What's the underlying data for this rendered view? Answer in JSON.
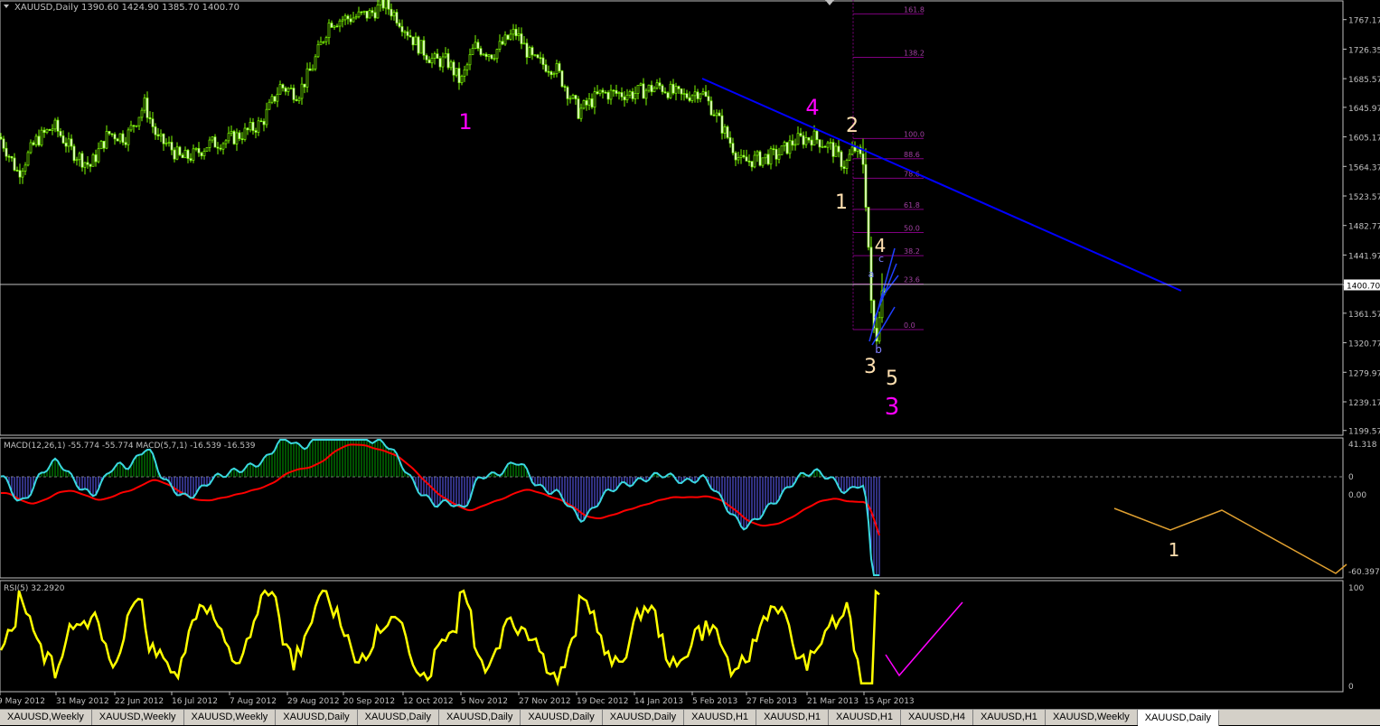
{
  "window_title": "XAUUSD,Daily",
  "header": {
    "symbol": "XAUUSD,Daily",
    "ohlc": "1390.60 1424.90 1385.70 1400.70"
  },
  "current_price": "1400.70",
  "chart_data": [
    {
      "type": "candlestick",
      "title": "XAUUSD,Daily",
      "y_ticks": [
        "1767.17",
        "1726.35",
        "1685.57",
        "1645.97",
        "1605.17",
        "1564.37",
        "1523.57",
        "1482.77",
        "1441.97",
        "1400.70",
        "1361.57",
        "1320.77",
        "1279.97",
        "1239.17",
        "1199.57"
      ],
      "ylim": [
        1193,
        1793
      ],
      "x_ticks": [
        "9 May 2012",
        "31 May 2012",
        "22 Jun 2012",
        "16 Jul 2012",
        "7 Aug 2012",
        "29 Aug 2012",
        "20 Sep 2012",
        "12 Oct 2012",
        "5 Nov 2012",
        "27 Nov 2012",
        "19 Dec 2012",
        "14 Jan 2013",
        "5 Feb 2013",
        "27 Feb 2013",
        "21 Mar 2013",
        "15 Apr 2013"
      ],
      "close_anchors": [
        [
          0,
          1605
        ],
        [
          20,
          1555
        ],
        [
          40,
          1600
        ],
        [
          60,
          1620
        ],
        [
          80,
          1585
        ],
        [
          100,
          1565
        ],
        [
          120,
          1610
        ],
        [
          140,
          1605
        ],
        [
          160,
          1650
        ],
        [
          175,
          1600
        ],
        [
          185,
          1595
        ],
        [
          200,
          1575
        ],
        [
          215,
          1580
        ],
        [
          230,
          1595
        ],
        [
          250,
          1600
        ],
        [
          270,
          1610
        ],
        [
          290,
          1625
        ],
        [
          310,
          1675
        ],
        [
          330,
          1665
        ],
        [
          345,
          1700
        ],
        [
          365,
          1765
        ],
        [
          390,
          1770
        ],
        [
          410,
          1775
        ],
        [
          425,
          1790
        ],
        [
          440,
          1770
        ],
        [
          460,
          1735
        ],
        [
          480,
          1710
        ],
        [
          495,
          1710
        ],
        [
          510,
          1680
        ],
        [
          525,
          1730
        ],
        [
          545,
          1720
        ],
        [
          570,
          1750
        ],
        [
          590,
          1710
        ],
        [
          615,
          1700
        ],
        [
          640,
          1640
        ],
        [
          665,
          1665
        ],
        [
          680,
          1665
        ],
        [
          700,
          1665
        ],
        [
          730,
          1675
        ],
        [
          755,
          1660
        ],
        [
          775,
          1670
        ],
        [
          790,
          1640
        ],
        [
          805,
          1605
        ],
        [
          820,
          1570
        ],
        [
          840,
          1575
        ],
        [
          860,
          1580
        ],
        [
          880,
          1600
        ],
        [
          900,
          1605
        ],
        [
          920,
          1590
        ],
        [
          935,
          1565
        ],
        [
          945,
          1590
        ],
        [
          955,
          1570
        ],
        [
          960,
          1480
        ],
        [
          965,
          1345
        ],
        [
          970,
          1330
        ],
        [
          975,
          1390
        ],
        [
          980,
          1400
        ]
      ],
      "fibonacci": [
        {
          "label": "161.8",
          "price": 1775
        },
        {
          "label": "138.2",
          "price": 1715
        },
        {
          "label": "100.0",
          "price": 1603
        },
        {
          "label": "88.6",
          "price": 1575
        },
        {
          "label": "78.6",
          "price": 1548
        },
        {
          "label": "61.8",
          "price": 1505
        },
        {
          "label": "50.0",
          "price": 1473
        },
        {
          "label": "38.2",
          "price": 1441
        },
        {
          "label": "23.6",
          "price": 1402
        },
        {
          "label": "0.0",
          "price": 1339
        }
      ],
      "wave_labels": [
        {
          "text": "1",
          "color": "#ff00ff",
          "x": 515,
          "y": 143,
          "size": 24
        },
        {
          "text": "4",
          "color": "#ff00ff",
          "x": 899,
          "y": 127,
          "size": 24
        },
        {
          "text": "2",
          "color": "#ffe0b0",
          "x": 943,
          "y": 146,
          "size": 22
        },
        {
          "text": "1",
          "color": "#ffe0b0",
          "x": 931,
          "y": 231,
          "size": 22
        },
        {
          "text": "4",
          "color": "#ffe0b0",
          "x": 974,
          "y": 279,
          "size": 20
        },
        {
          "text": "3",
          "color": "#ffe0b0",
          "x": 963,
          "y": 413,
          "size": 22
        },
        {
          "text": "5",
          "color": "#ffe0b0",
          "x": 987,
          "y": 426,
          "size": 22
        },
        {
          "text": "3",
          "color": "#ff00ff",
          "x": 987,
          "y": 459,
          "size": 26
        },
        {
          "text": "b",
          "color": "#8080ff",
          "x": 972,
          "y": 391,
          "size": 12
        },
        {
          "text": "a",
          "color": "#8080ff",
          "x": 964,
          "y": 307,
          "size": 11
        },
        {
          "text": "c",
          "color": "#8080ff",
          "x": 975,
          "y": 290,
          "size": 11
        }
      ]
    },
    {
      "type": "histogram",
      "title": "MACD(12,26,1) -55.774 -55.774 MACD(5,7,1) -16.539 -16.539",
      "y_ticks": [
        "41.318",
        "0",
        "0.00",
        "-60.397"
      ],
      "wave_label": {
        "text": "1",
        "color": "#ffe0b0"
      }
    },
    {
      "type": "line",
      "title": "RSI(5) 32.2920",
      "y_ticks": [
        "100",
        "0"
      ],
      "ylim": [
        0,
        100
      ]
    }
  ],
  "tabs": [
    {
      "label": "XAUUSD,Weekly",
      "active": false
    },
    {
      "label": "XAUUSD,Weekly",
      "active": false
    },
    {
      "label": "XAUUSD,Weekly",
      "active": false
    },
    {
      "label": "XAUUSD,Daily",
      "active": false
    },
    {
      "label": "XAUUSD,Daily",
      "active": false
    },
    {
      "label": "XAUUSD,Daily",
      "active": false
    },
    {
      "label": "XAUUSD,Daily",
      "active": false
    },
    {
      "label": "XAUUSD,Daily",
      "active": false
    },
    {
      "label": "XAUUSD,H1",
      "active": false
    },
    {
      "label": "XAUUSD,H1",
      "active": false
    },
    {
      "label": "XAUUSD,H1",
      "active": false
    },
    {
      "label": "XAUUSD,H4",
      "active": false
    },
    {
      "label": "XAUUSD,H1",
      "active": false
    },
    {
      "label": "XAUUSD,Weekly",
      "active": false
    },
    {
      "label": "XAUUSD,Daily",
      "active": true
    }
  ],
  "colors": {
    "bg": "#000000",
    "candle": "#7cfc00",
    "axis": "#c0c0c0",
    "trendline": "#0000ff",
    "fib": "#800080",
    "macd_main": "#3ad7e0",
    "macd_signal": "#ff0000",
    "macd_hist_pos": "#00a000",
    "macd_hist_neg": "#6060ff",
    "rsi": "#ffff00",
    "rsi_projection": "#ff00ff",
    "macd_projection": "#e0a030"
  }
}
